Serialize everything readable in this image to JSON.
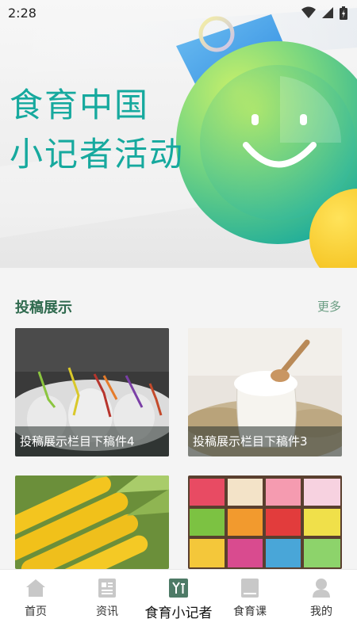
{
  "status_bar": {
    "time": "2:28"
  },
  "banner": {
    "title_line1": "食育中国",
    "title_line2": "小记者活动",
    "colors": {
      "text": "#16a99e",
      "circle_light": "#b3eb58",
      "circle_dark": "#1fb8a0",
      "accent_yellow": "#f9d11c",
      "accent_blue": "#3f9de8"
    }
  },
  "section": {
    "title": "投稿展示",
    "more": "更多"
  },
  "cards": [
    {
      "caption": "投稿展示栏目下稿件4",
      "image": "cocktail-glasses"
    },
    {
      "caption": "投稿展示栏目下稿件3",
      "image": "flour-sack"
    },
    {
      "caption": "",
      "image": "corn"
    },
    {
      "caption": "",
      "image": "candy-bins"
    }
  ],
  "nav": {
    "items": [
      {
        "label": "首页",
        "icon": "home-icon"
      },
      {
        "label": "资讯",
        "icon": "news-icon"
      },
      {
        "label": "食育小记者",
        "icon": "reporter-icon",
        "active": true
      },
      {
        "label": "食育课",
        "icon": "book-icon"
      },
      {
        "label": "我的",
        "icon": "user-icon"
      }
    ],
    "active_color": "#4d7a66",
    "inactive_color": "#c8c8c8"
  }
}
